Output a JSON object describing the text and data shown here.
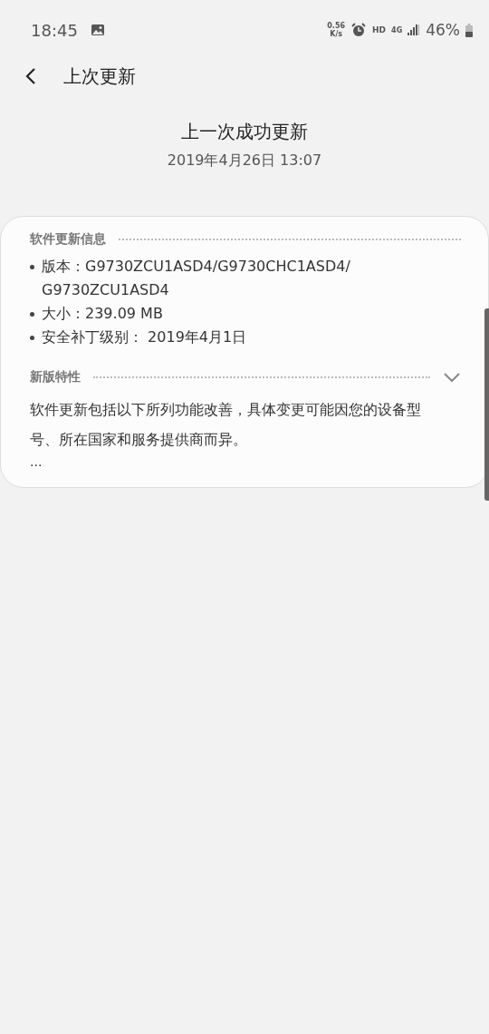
{
  "status_bar": {
    "time": "18:45",
    "speed_value": "0.56",
    "speed_unit": "K/s",
    "hd": "HD",
    "network": "4G",
    "battery": "46%"
  },
  "header": {
    "title": "上次更新"
  },
  "summary": {
    "title": "上一次成功更新",
    "date": "2019年4月26日 13:07"
  },
  "card": {
    "info_heading": "软件更新信息",
    "info_items": [
      "版本：G9730ZCU1ASD4/G9730CHC1ASD4/ G9730ZCU1ASD4",
      "大小：239.09 MB",
      "安全补丁级别： 2019年4月1日"
    ],
    "features": {
      "heading": "新版特性",
      "expanded": false,
      "text": "软件更新包括以下所列功能改善，具体变更可能因您的设备型号、所在国家和服务提供商而异。",
      "more": "..."
    }
  }
}
